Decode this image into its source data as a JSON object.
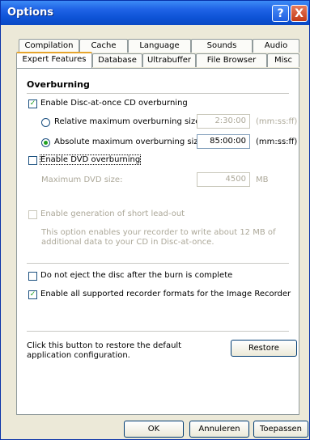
{
  "window": {
    "title": "Options"
  },
  "titlebar": {
    "help_glyph": "?",
    "close_glyph": "X"
  },
  "tabs_row1": [
    "Compilation",
    "Cache",
    "Language",
    "Sounds",
    "Audio"
  ],
  "tabs_row2": [
    "Expert Features",
    "Database",
    "Ultrabuffer",
    "File Browser",
    "Misc"
  ],
  "active_tab": "Expert Features",
  "overburning": {
    "group_title": "Overburning",
    "enable_dao_label": "Enable Disc-at-once CD overburning",
    "enable_dao_checked": true,
    "relative_label": "Relative maximum overburning size:",
    "relative_value": "2:30:00",
    "relative_unit": "(mm:ss:ff)",
    "relative_selected": false,
    "absolute_label": "Absolute maximum overburning size:",
    "absolute_value": "85:00:00",
    "absolute_unit": "(mm:ss:ff)",
    "absolute_selected": true,
    "enable_dvd_label": "Enable DVD overburning",
    "enable_dvd_checked": false,
    "max_dvd_label": "Maximum DVD size:",
    "max_dvd_value": "4500",
    "max_dvd_unit": "MB"
  },
  "leadout": {
    "label": "Enable generation of short lead-out",
    "checked": false,
    "description": "This option enables your recorder to write about 12 MB of additional data to your CD in Disc-at-once."
  },
  "no_eject": {
    "label": "Do not eject the disc after the burn is complete",
    "checked": false
  },
  "image_recorder": {
    "label": "Enable all supported recorder formats for the Image Recorder",
    "checked": true
  },
  "restore": {
    "text": "Click this button to restore the default application configuration.",
    "button_label": "Restore"
  },
  "footer": {
    "ok": "OK",
    "cancel": "Annuleren",
    "apply": "Toepassen"
  }
}
